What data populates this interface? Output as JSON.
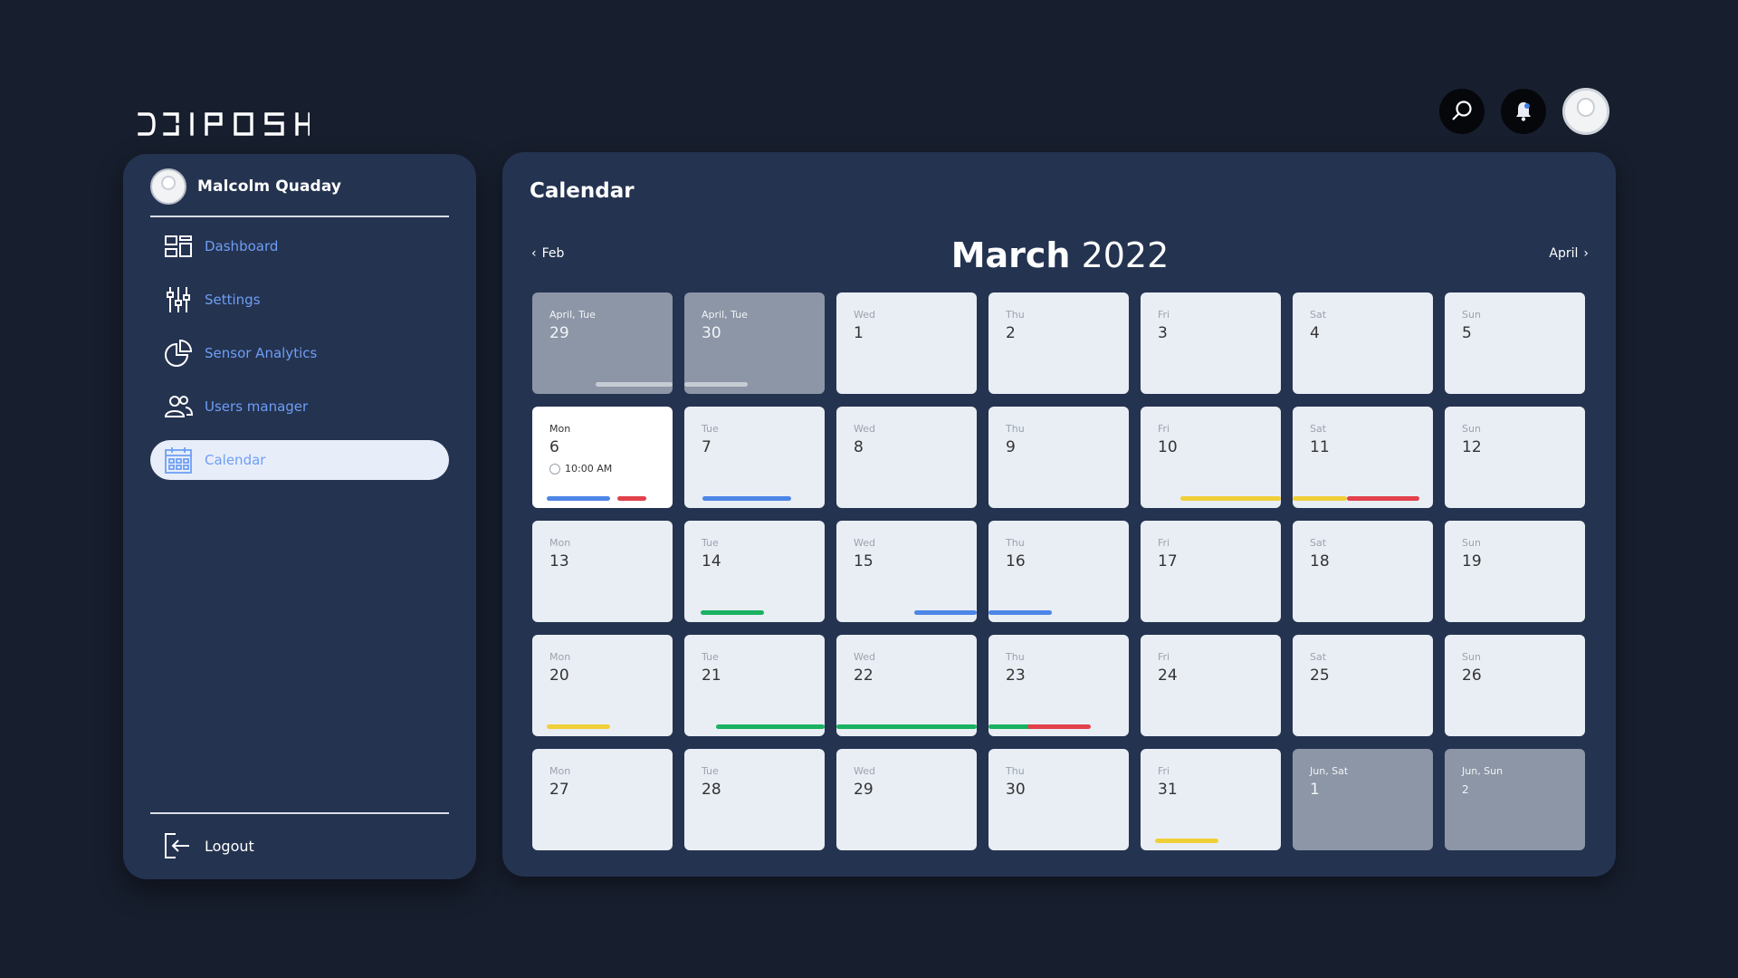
{
  "brand": {
    "name": "DRIPOSH"
  },
  "colors": {
    "background": "#171e2d",
    "panel": "#243350",
    "accent": "#6e9ef5",
    "event_blue": "#4d86e6",
    "event_red": "#e2414b",
    "event_yellow": "#efd037",
    "event_green": "#1ab262"
  },
  "header": {
    "icons": [
      "search-icon",
      "bell-icon",
      "avatar"
    ]
  },
  "sidebar": {
    "user_name": "Malcolm Quaday",
    "items": [
      {
        "label": "Dashboard",
        "icon": "dashboard-icon"
      },
      {
        "label": "Settings",
        "icon": "sliders-icon"
      },
      {
        "label": "Sensor Analytics",
        "icon": "pie-chart-icon"
      },
      {
        "label": "Users manager",
        "icon": "users-icon"
      },
      {
        "label": "Calendar",
        "icon": "calendar-icon",
        "active": true
      }
    ],
    "logout_label": "Logout"
  },
  "calendar": {
    "title": "Calendar",
    "prev_label": "Feb",
    "next_label": "April",
    "month": "March",
    "year": "2022",
    "days": [
      {
        "dow": "April, Tue",
        "num": "29",
        "state": "other",
        "bars": [
          "grey"
        ]
      },
      {
        "dow": "April, Tue",
        "num": "30",
        "state": "other",
        "bars": [
          "grey"
        ]
      },
      {
        "dow": "Wed",
        "num": "1"
      },
      {
        "dow": "Thu",
        "num": "2"
      },
      {
        "dow": "Fri",
        "num": "3"
      },
      {
        "dow": "Sat",
        "num": "4"
      },
      {
        "dow": "Sun",
        "num": "5"
      },
      {
        "dow": "Mon",
        "num": "6",
        "state": "today",
        "time": "10:00 AM",
        "bars": [
          "blue",
          "red"
        ]
      },
      {
        "dow": "Tue",
        "num": "7",
        "bars": [
          "blue"
        ]
      },
      {
        "dow": "Wed",
        "num": "8"
      },
      {
        "dow": "Thu",
        "num": "9"
      },
      {
        "dow": "Fri",
        "num": "10",
        "bars": [
          "yellow"
        ]
      },
      {
        "dow": "Sat",
        "num": "11",
        "bars": [
          "yellow",
          "red"
        ]
      },
      {
        "dow": "Sun",
        "num": "12"
      },
      {
        "dow": "Mon",
        "num": "13"
      },
      {
        "dow": "Tue",
        "num": "14",
        "bars": [
          "green"
        ]
      },
      {
        "dow": "Wed",
        "num": "15",
        "bars": [
          "blue"
        ]
      },
      {
        "dow": "Thu",
        "num": "16",
        "bars": [
          "blue"
        ]
      },
      {
        "dow": "Fri",
        "num": "17"
      },
      {
        "dow": "Sat",
        "num": "18"
      },
      {
        "dow": "Sun",
        "num": "19"
      },
      {
        "dow": "Mon",
        "num": "20",
        "bars": [
          "yellow"
        ]
      },
      {
        "dow": "Tue",
        "num": "21",
        "bars": [
          "green"
        ]
      },
      {
        "dow": "Wed",
        "num": "22",
        "bars": [
          "green"
        ]
      },
      {
        "dow": "Thu",
        "num": "23",
        "bars": [
          "green",
          "red"
        ]
      },
      {
        "dow": "Fri",
        "num": "24"
      },
      {
        "dow": "Sat",
        "num": "25"
      },
      {
        "dow": "Sun",
        "num": "26"
      },
      {
        "dow": "Mon",
        "num": "27"
      },
      {
        "dow": "Tue",
        "num": "28"
      },
      {
        "dow": "Wed",
        "num": "29"
      },
      {
        "dow": "Thu",
        "num": "30"
      },
      {
        "dow": "Fri",
        "num": "31",
        "bars": [
          "yellow"
        ]
      },
      {
        "dow": "Jun, Sat",
        "num": "1",
        "state": "other"
      },
      {
        "dow": "Jun, Sun",
        "num": "2",
        "state": "other",
        "small": true
      }
    ]
  }
}
